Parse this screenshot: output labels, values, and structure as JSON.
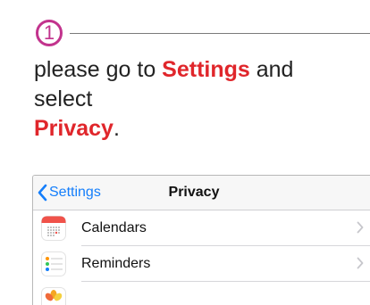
{
  "step": {
    "number": "1"
  },
  "instruction": {
    "prefix": "please go to ",
    "settings": "Settings",
    "middle": " and select ",
    "privacy": "Privacy",
    "suffix": "."
  },
  "navbar": {
    "back_label": "Settings",
    "title": "Privacy"
  },
  "list": {
    "items": [
      {
        "label": "Calendars",
        "icon": "calendar-icon"
      },
      {
        "label": "Reminders",
        "icon": "reminders-icon"
      },
      {
        "label": "",
        "icon": "photos-icon"
      }
    ]
  },
  "colors": {
    "step_accent": "#c2338d",
    "highlight": "#e0262b",
    "ios_blue": "#147efb"
  }
}
